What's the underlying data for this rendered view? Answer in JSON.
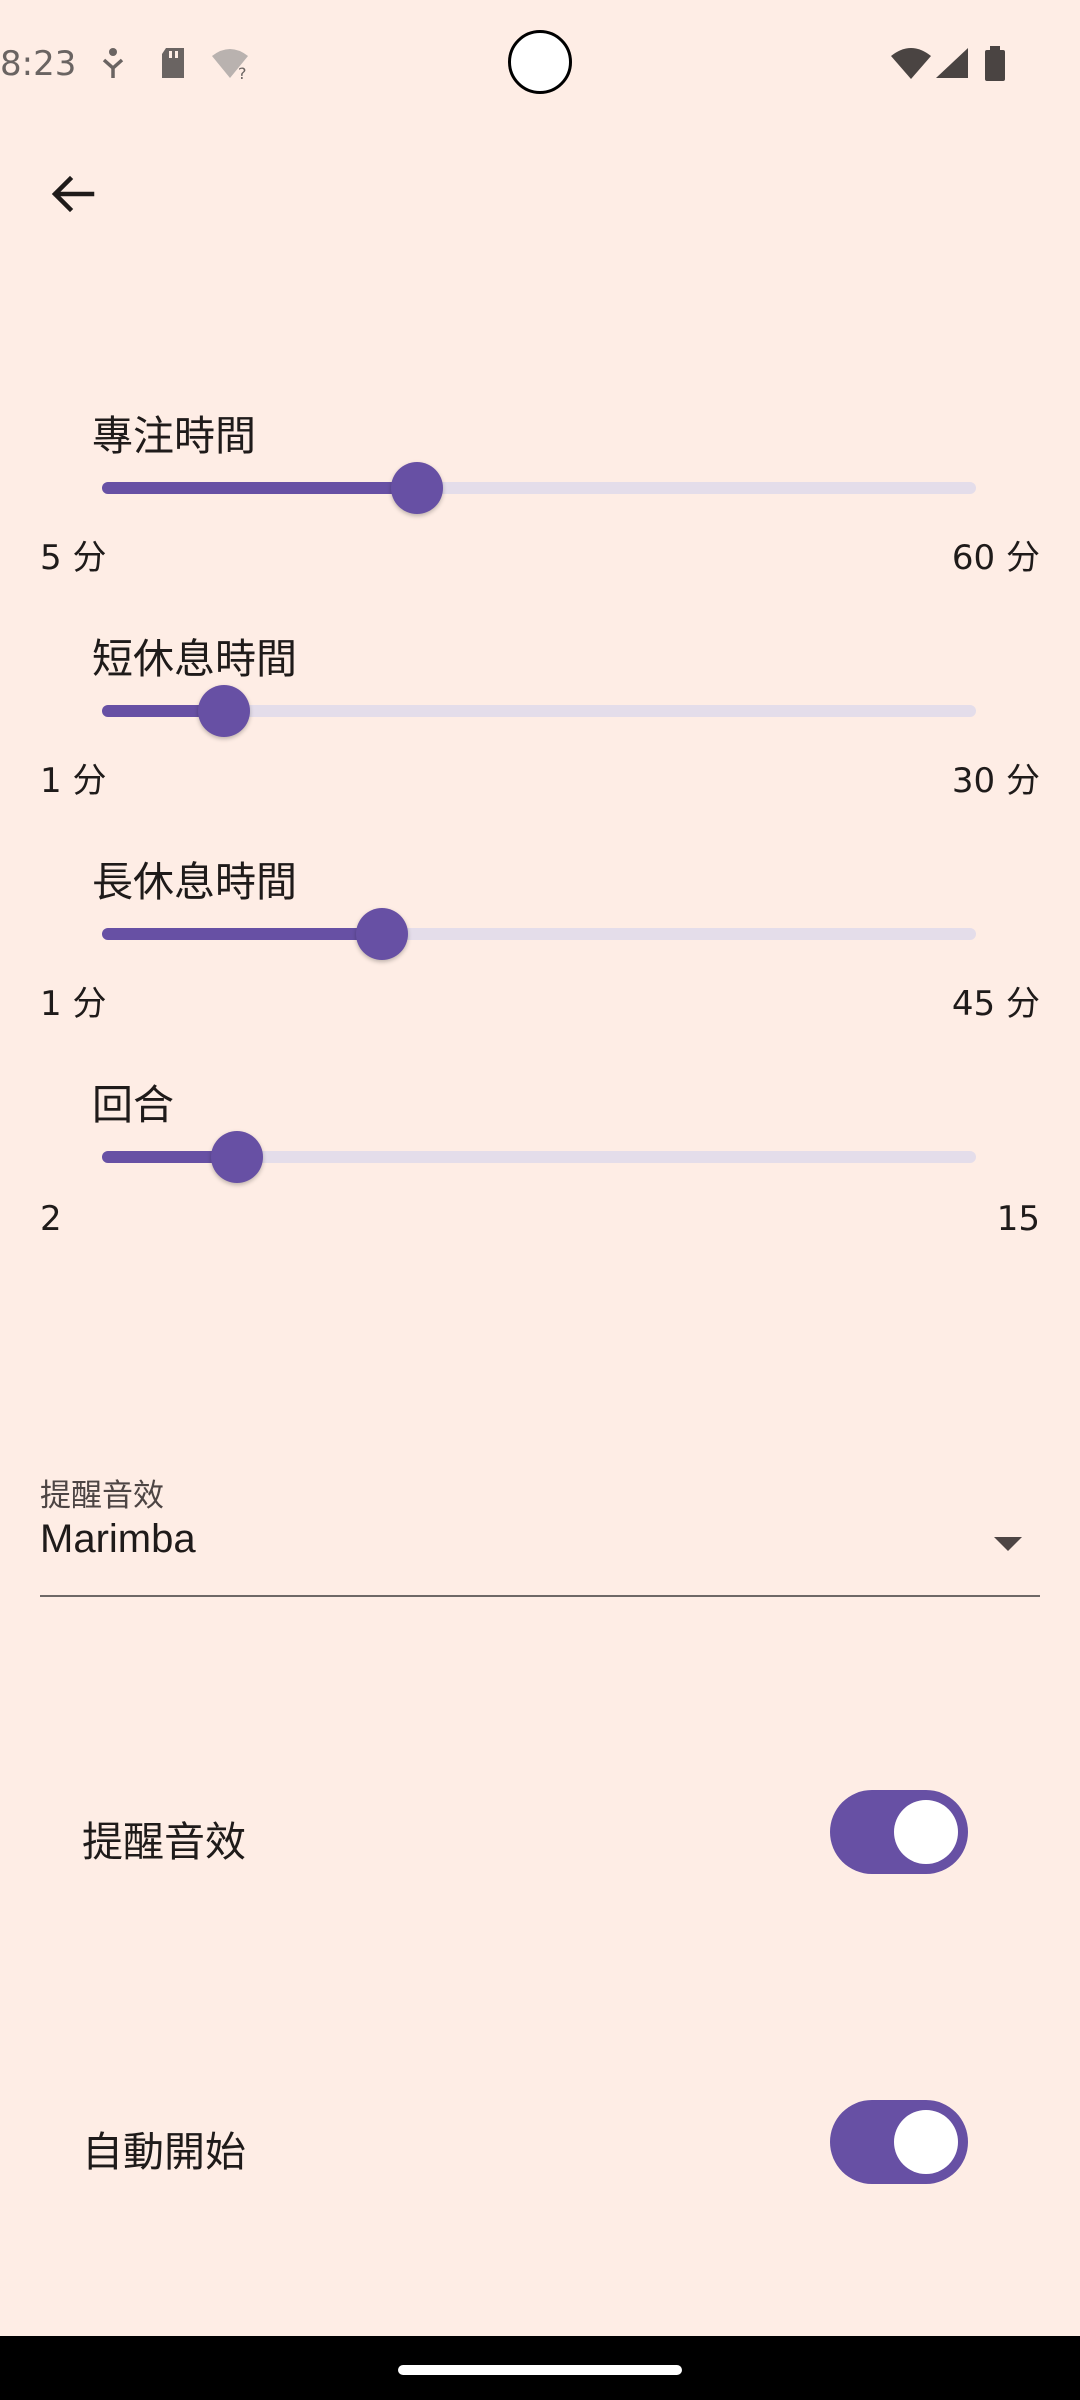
{
  "status_bar": {
    "time": "8:23",
    "left_icons": [
      "accessibility-icon",
      "sd-card-icon",
      "wifi-question-icon"
    ],
    "right_icons": [
      "wifi-icon",
      "signal-icon",
      "battery-icon"
    ]
  },
  "app_bar": {
    "back_icon": "arrow-back-icon"
  },
  "sliders": [
    {
      "title": "專注時間",
      "min_label": "5 分",
      "max_label": "60 分",
      "fraction": 0.36
    },
    {
      "title": "短休息時間",
      "min_label": "1 分",
      "max_label": "30 分",
      "fraction": 0.14
    },
    {
      "title": "長休息時間",
      "min_label": "1 分",
      "max_label": "45 分",
      "fraction": 0.32
    },
    {
      "title": "回合",
      "min_label": "2",
      "max_label": "15",
      "fraction": 0.155
    }
  ],
  "sound_dropdown": {
    "label": "提醒音效",
    "value": "Marimba"
  },
  "switches": [
    {
      "label": "提醒音效",
      "on": true
    },
    {
      "label": "自動開始",
      "on": true
    }
  ],
  "colors": {
    "background": "#FEEDE5",
    "accent": "#6750A4",
    "track_inactive": "#E4DDEA"
  }
}
